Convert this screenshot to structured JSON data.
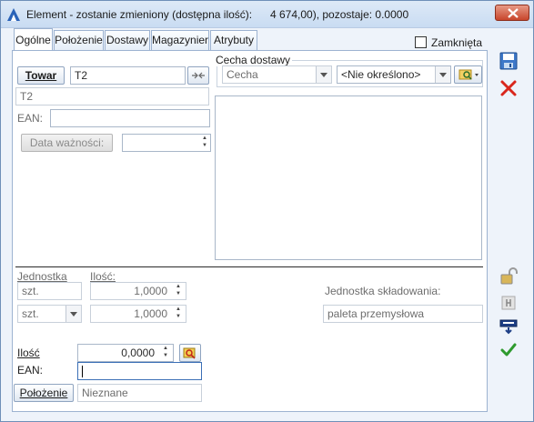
{
  "window": {
    "title": "Element - zostanie zmieniony (dostępna ilość):",
    "title_amount": "4 674,00), pozostaje: 0.0000"
  },
  "tabs": [
    {
      "label": "Ogólne",
      "active": true
    },
    {
      "label": "Położenie"
    },
    {
      "label": "Dostawy"
    },
    {
      "label": "Magazynier"
    },
    {
      "label": "Atrybuty"
    }
  ],
  "zamknieta": {
    "label": "Zamknięta",
    "checked": false
  },
  "towar": {
    "button": "Towar",
    "code": "T2",
    "name": "T2"
  },
  "ean_top": {
    "label": "EAN:",
    "value": ""
  },
  "expiry": {
    "button": "Data ważności:",
    "value": ""
  },
  "cecha_dostawy": {
    "legend": "Cecha dostawy",
    "cecha_value": "Cecha",
    "option_value": "<Nie określono>"
  },
  "units": {
    "jednostka_label": "Jednostka",
    "ilosc_label": "Ilość:",
    "row1": {
      "unit": "szt.",
      "qty": "1,0000"
    },
    "row2": {
      "unit": "szt.",
      "qty": "1,0000"
    },
    "storage_label": "Jednostka składowania:",
    "storage_value": "paleta przemysłowa"
  },
  "quantity": {
    "label": "Ilość",
    "value": "0,0000"
  },
  "ean_bottom": {
    "label": "EAN:",
    "value": ""
  },
  "location": {
    "button": "Położenie",
    "value": "Nieznane"
  },
  "colors": {
    "accent": "#3b6fb6",
    "title_bg": "#cddff3",
    "cancel_red": "#d9261c",
    "confirm_green": "#2e9a2e"
  }
}
